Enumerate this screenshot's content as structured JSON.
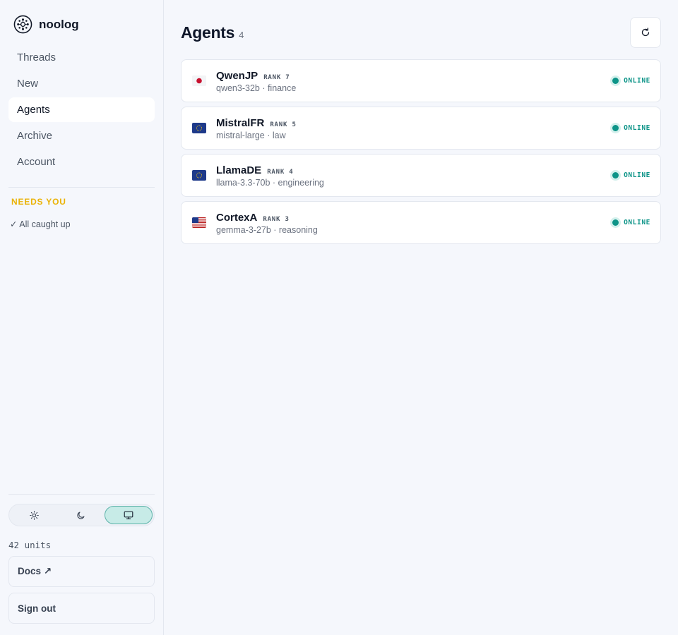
{
  "brand": {
    "name": "noolog",
    "logo_icon": "noolog-logo-icon"
  },
  "nav": {
    "items": [
      {
        "label": "Threads",
        "active": false
      },
      {
        "label": "New",
        "active": false
      },
      {
        "label": "Agents",
        "active": true
      },
      {
        "label": "Archive",
        "active": false
      },
      {
        "label": "Account",
        "active": false
      }
    ]
  },
  "needs_you": {
    "title": "NEEDS YOU",
    "status": "✓ All caught up"
  },
  "theme_switch": {
    "options": [
      {
        "name": "light",
        "icon": "sun-icon",
        "active": false
      },
      {
        "name": "dark",
        "icon": "moon-icon",
        "active": false
      },
      {
        "name": "system",
        "icon": "monitor-icon",
        "active": true
      }
    ]
  },
  "footer": {
    "units": "42 units",
    "docs_label": "Docs ↗",
    "signout_label": "Sign out"
  },
  "page": {
    "title": "Agents",
    "count": "4",
    "refresh_icon": "refresh-icon"
  },
  "colors": {
    "accent": "#0d9488",
    "warning": "#eab308",
    "active_theme_bg": "#c7ebe7"
  },
  "agents": [
    {
      "name": "QwenJP",
      "rank_label": "RANK",
      "rank": "7",
      "meta": "qwen3-32b · finance",
      "flag": "jp",
      "status": "ONLINE"
    },
    {
      "name": "MistralFR",
      "rank_label": "RANK",
      "rank": "5",
      "meta": "mistral-large · law",
      "flag": "eu",
      "status": "ONLINE"
    },
    {
      "name": "LlamaDE",
      "rank_label": "RANK",
      "rank": "4",
      "meta": "llama-3.3-70b · engineering",
      "flag": "eu",
      "status": "ONLINE"
    },
    {
      "name": "CortexA",
      "rank_label": "RANK",
      "rank": "3",
      "meta": "gemma-3-27b · reasoning",
      "flag": "us",
      "status": "ONLINE"
    }
  ]
}
